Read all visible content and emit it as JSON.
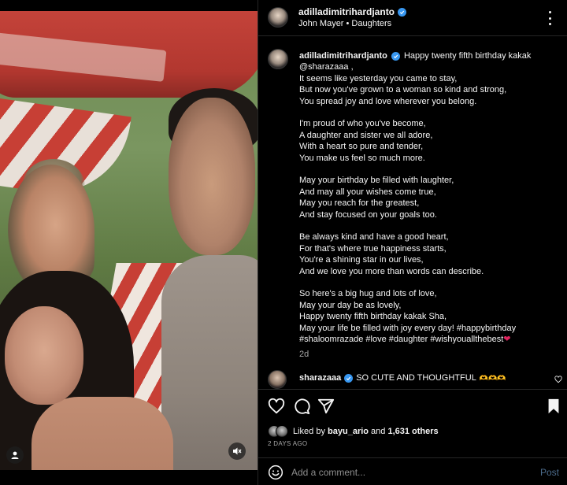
{
  "header": {
    "username": "adilladimitrihardjanto",
    "subtitle": "John Mayer • Daughters"
  },
  "caption": {
    "username": "adilladimitrihardjanto",
    "line1": "Happy twenty fifth birthday kakak",
    "line2": "@sharazaaa ,",
    "stanza1": [
      "It seems like yesterday you came to stay,",
      "But now you've grown to a woman so kind and strong,",
      "You spread joy and love wherever you belong."
    ],
    "stanza2": [
      "I'm proud of who you've become,",
      "A daughter and sister we all adore,",
      "With a heart so pure and tender,",
      "You make us feel so much more."
    ],
    "stanza3": [
      "May your birthday be filled with laughter,",
      "And may all your wishes come true,",
      "May you reach for the greatest,",
      "And stay focused on your goals too."
    ],
    "stanza4": [
      "Be always kind and have a good heart,",
      "For that's where true happiness starts,",
      "You're a shining star in our lives,",
      "And we love you more than words can describe."
    ],
    "stanza5": [
      "So here's a big hug and lots of love,",
      "May your day be as lovely,",
      "Happy twenty fifth birthday kakak Sha,",
      "May your life be filled with joy every day! #happybirthday",
      "#shaloomrazade #love #daughter #wishyouallthebest"
    ],
    "heart": "❤",
    "time": "2d"
  },
  "comment": {
    "username": "sharazaaa",
    "text": "SO CUTE AND THOUGHTFUL",
    "emoji": "🫶🫶🫶"
  },
  "actions": {
    "liked_by_prefix": "Liked by ",
    "liked_by_user": "bayu_ario",
    "liked_by_and": " and ",
    "liked_by_count": "1,631 others",
    "date": "2 DAYS AGO"
  },
  "add_comment": {
    "placeholder": "Add a comment...",
    "post_label": "Post"
  },
  "colors": {
    "background": "#000000",
    "text": "#f5f5f5",
    "secondary": "#a8a8a8",
    "verified": "#3897f0",
    "post_disabled": "#4b6a8a"
  }
}
